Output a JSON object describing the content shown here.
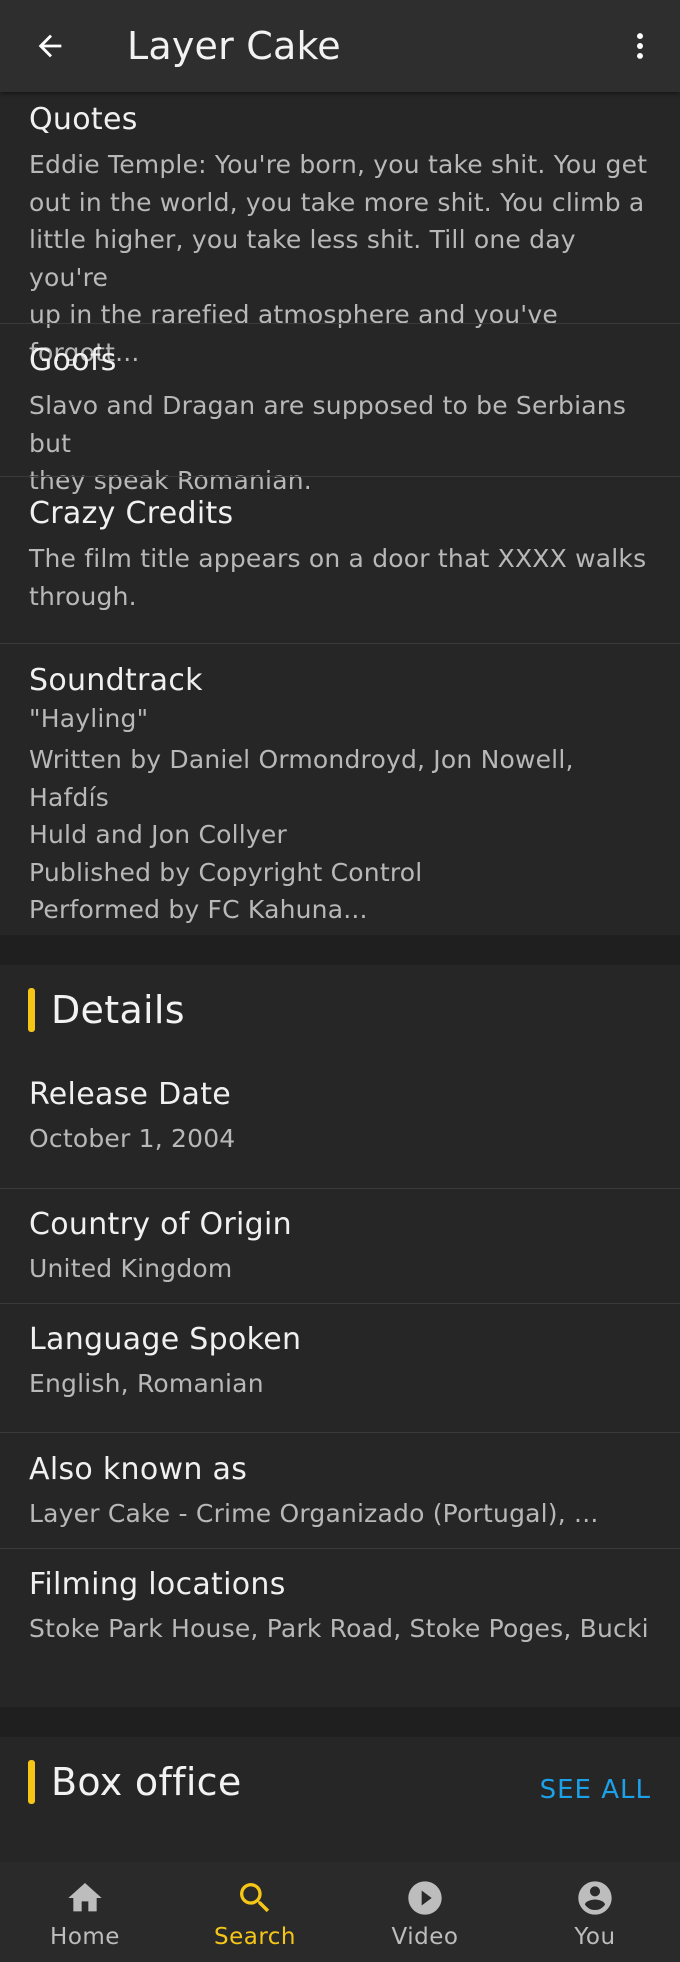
{
  "app_bar": {
    "title": "Layer Cake"
  },
  "trivia": {
    "quotes": {
      "heading": "Quotes",
      "lines": [
        "Eddie Temple: You're born, you take shit. You get",
        "out in the world, you take more shit. You climb a",
        "little higher, you take less shit. Till one day you're",
        "up in the rarefied atmosphere and you've forgott..."
      ]
    },
    "goofs": {
      "heading": "Goofs",
      "lines": [
        "Slavo and Dragan are supposed to be Serbians but",
        "they speak Romanian."
      ]
    },
    "crazy_credits": {
      "heading": "Crazy Credits",
      "lines": [
        "The film title appears on a door that XXXX walks",
        "through."
      ]
    },
    "soundtrack": {
      "heading": "Soundtrack",
      "lines": [
        "\"Hayling\"",
        "Written by Daniel Ormondroyd, Jon Nowell, Hafdís",
        "Huld and Jon Collyer",
        "Published by Copyright Control",
        "Performed by FC Kahuna..."
      ]
    }
  },
  "details": {
    "title": "Details",
    "rows": [
      {
        "label": "Release Date",
        "value": "October 1, 2004"
      },
      {
        "label": "Country of Origin",
        "value": "United Kingdom"
      },
      {
        "label": "Language Spoken",
        "value": "English, Romanian"
      },
      {
        "label": "Also known as",
        "value": "Layer Cake - Crime Organizado (Portugal), ..."
      },
      {
        "label": "Filming locations",
        "value": "Stoke Park House, Park Road, Stoke Poges, Bucki..."
      }
    ]
  },
  "box_office": {
    "title": "Box office",
    "see_all": "SEE ALL"
  },
  "bottom_nav": {
    "items": [
      {
        "label": "Home",
        "icon": "home-icon",
        "active": false
      },
      {
        "label": "Search",
        "icon": "search-icon",
        "active": true
      },
      {
        "label": "Video",
        "icon": "play-circle-icon",
        "active": false
      },
      {
        "label": "You",
        "icon": "account-circle-icon",
        "active": false
      }
    ]
  },
  "colors": {
    "accent": "#f5c518",
    "link": "#1ca1e8",
    "background": "#1f1f1f",
    "card": "#262626",
    "app_bar": "#2e2e2e"
  }
}
